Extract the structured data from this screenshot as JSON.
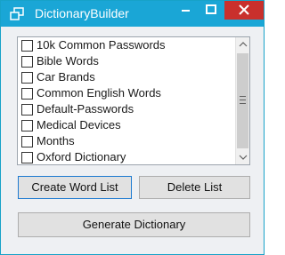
{
  "window": {
    "title": "DictionaryBuilder",
    "accent_color": "#1aa6d6",
    "close_color": "#c9302c",
    "controls": {
      "minimize_icon": "minimize-icon",
      "maximize_icon": "maximize-icon",
      "close_icon": "close-icon"
    }
  },
  "wordlist": {
    "items": [
      {
        "label": "10k Common Passwords",
        "checked": false
      },
      {
        "label": "Bible Words",
        "checked": false
      },
      {
        "label": "Car Brands",
        "checked": false
      },
      {
        "label": "Common English Words",
        "checked": false
      },
      {
        "label": "Default-Passwords",
        "checked": false
      },
      {
        "label": "Medical Devices",
        "checked": false
      },
      {
        "label": "Months",
        "checked": false
      },
      {
        "label": "Oxford Dictionary",
        "checked": false
      }
    ]
  },
  "buttons": {
    "create_label": "Create Word List",
    "delete_label": "Delete List",
    "generate_label": "Generate Dictionary"
  }
}
